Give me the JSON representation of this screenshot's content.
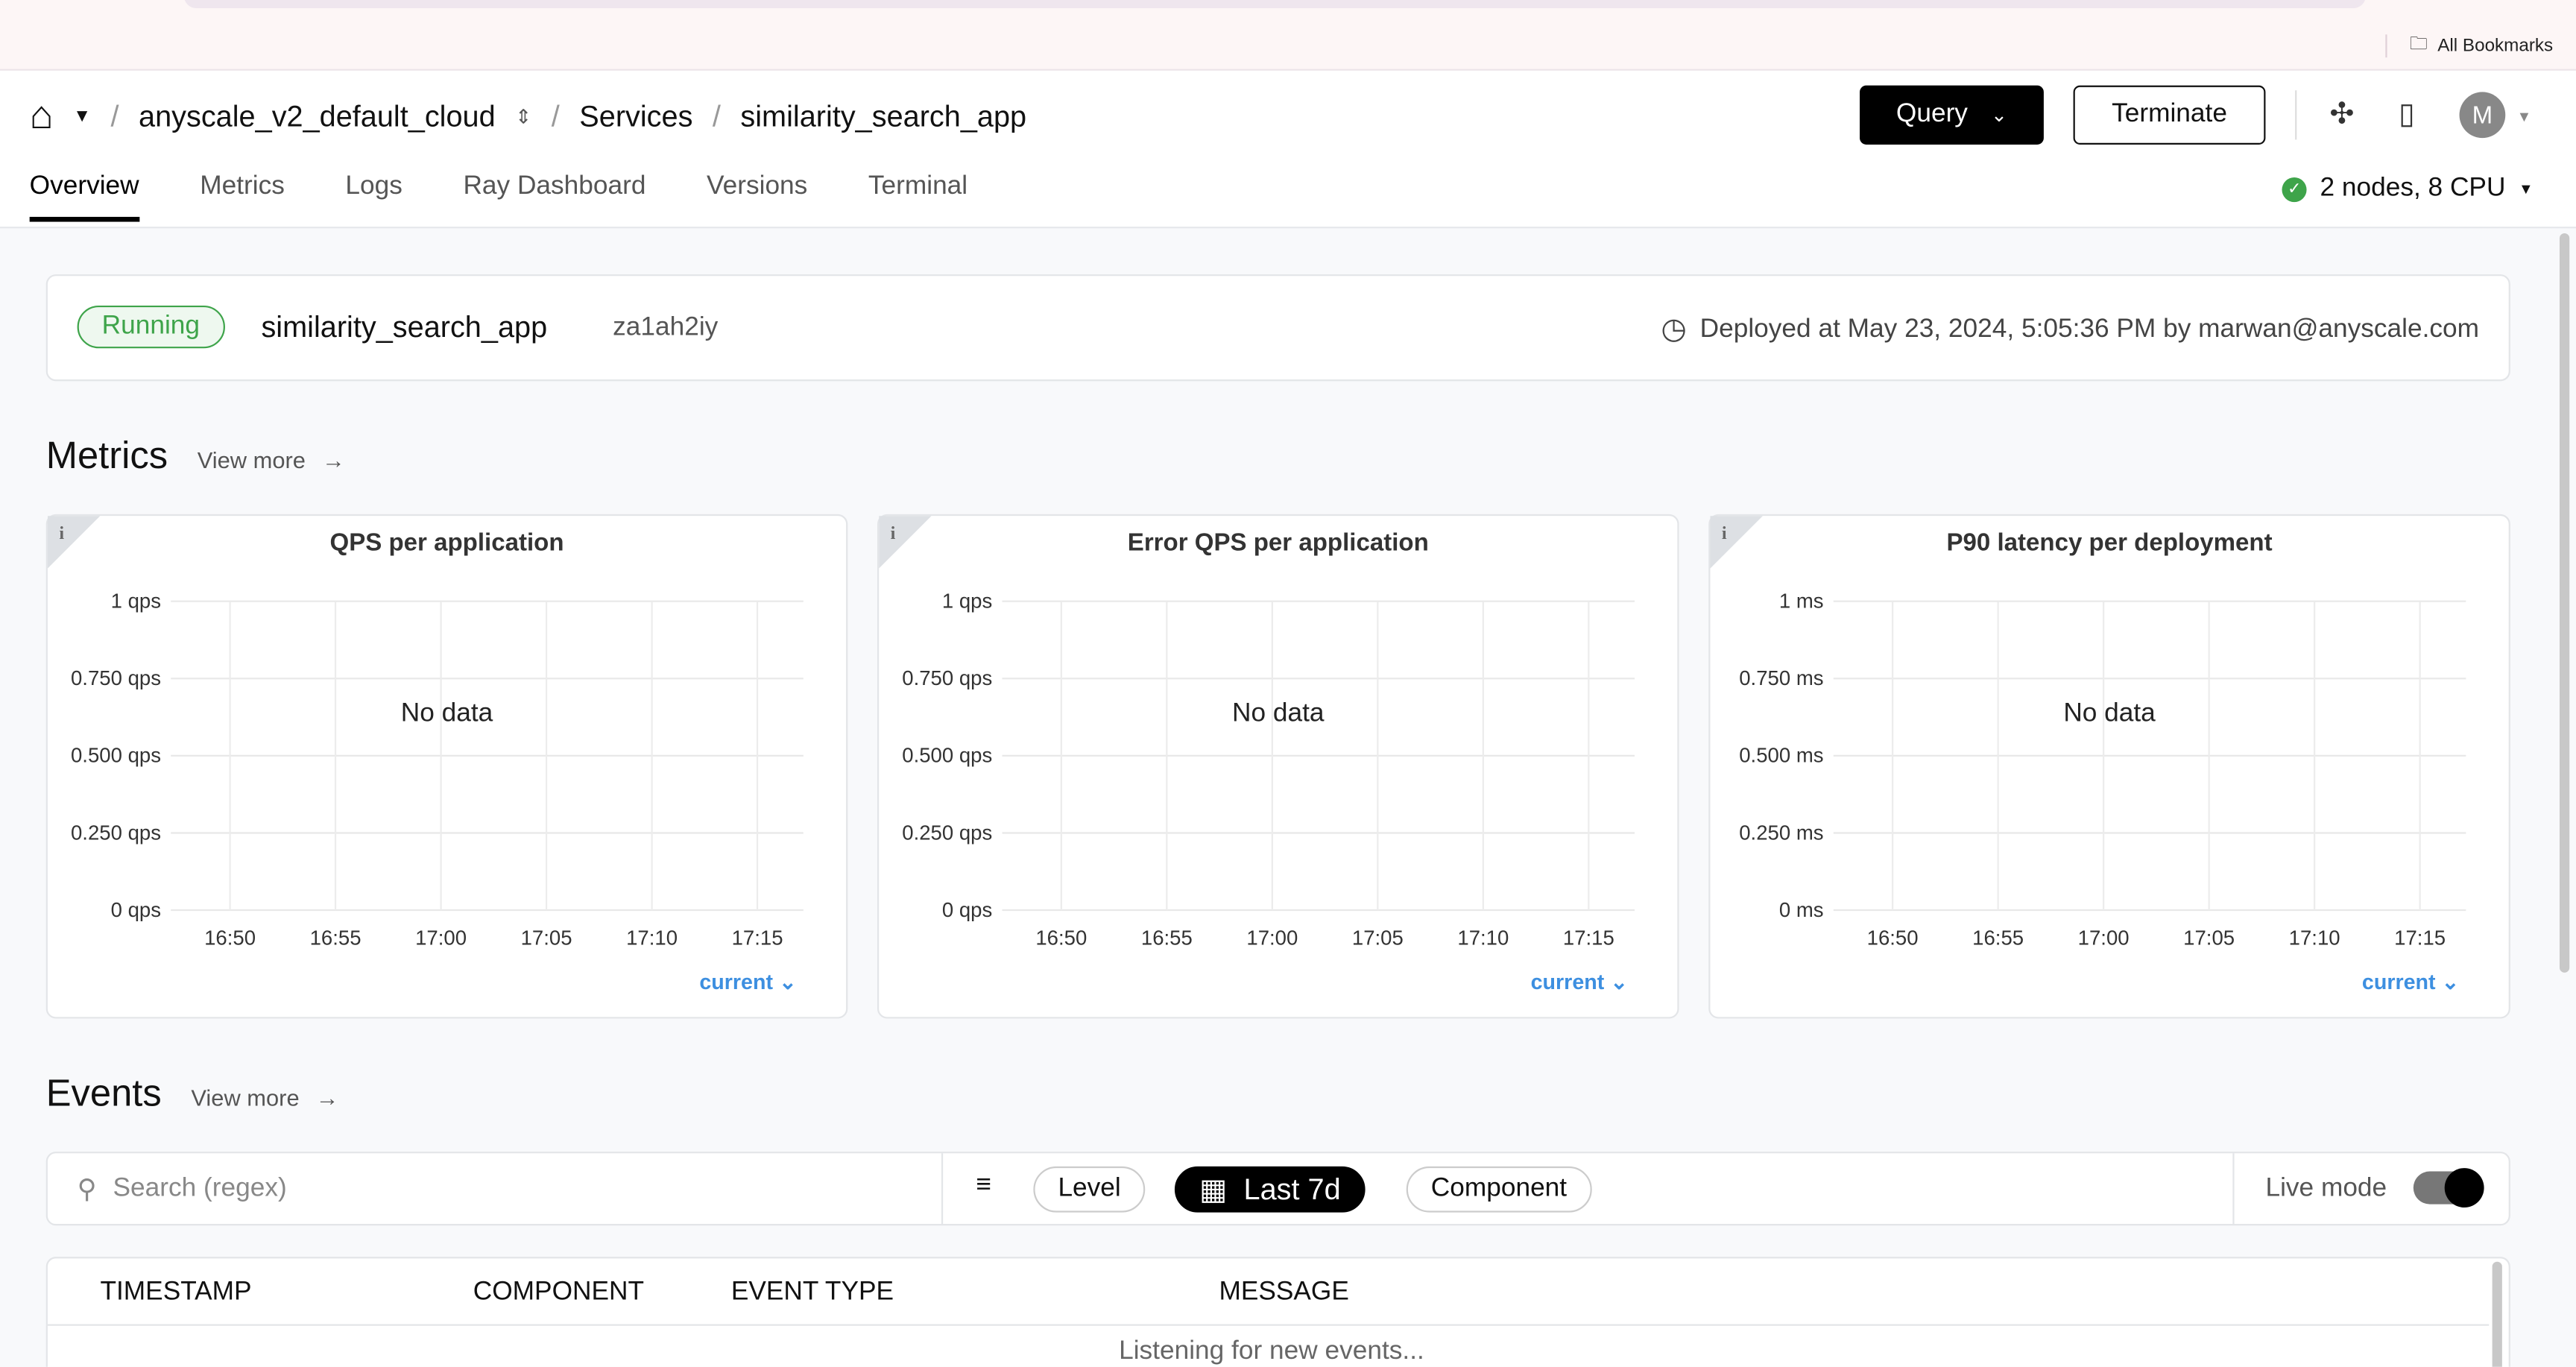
{
  "browser": {
    "bookmarks_label": "All Bookmarks"
  },
  "breadcrumb": {
    "cloud": "anyscale_v2_default_cloud",
    "section": "Services",
    "service": "similarity_search_app"
  },
  "header": {
    "query_label": "Query",
    "terminate_label": "Terminate",
    "avatar_initial": "M",
    "icons": [
      "slack-icon",
      "docs-icon"
    ]
  },
  "tabs": [
    {
      "label": "Overview",
      "active": true
    },
    {
      "label": "Metrics"
    },
    {
      "label": "Logs"
    },
    {
      "label": "Ray Dashboard"
    },
    {
      "label": "Versions"
    },
    {
      "label": "Terminal"
    }
  ],
  "cluster": {
    "summary": "2 nodes, 8 CPU",
    "status_color": "#3ea44a"
  },
  "status": {
    "state": "Running",
    "name": "similarity_search_app",
    "id": "za1ah2iy",
    "deployed": "Deployed at May 23, 2024, 5:05:36 PM by marwan@anyscale.com"
  },
  "metrics": {
    "title": "Metrics",
    "view_more": "View more"
  },
  "chart_data": [
    {
      "type": "line",
      "title": "QPS per application",
      "yticks": [
        "0 qps",
        "0.250 qps",
        "0.500 qps",
        "0.750 qps",
        "1 qps"
      ],
      "xticks": [
        "16:50",
        "16:55",
        "17:00",
        "17:05",
        "17:10",
        "17:15"
      ],
      "ylim": [
        0,
        1
      ],
      "grid": true,
      "series": [],
      "empty_text": "No data",
      "legend_label": "current"
    },
    {
      "type": "line",
      "title": "Error QPS per application",
      "yticks": [
        "0 qps",
        "0.250 qps",
        "0.500 qps",
        "0.750 qps",
        "1 qps"
      ],
      "xticks": [
        "16:50",
        "16:55",
        "17:00",
        "17:05",
        "17:10",
        "17:15"
      ],
      "ylim": [
        0,
        1
      ],
      "grid": true,
      "series": [],
      "empty_text": "No data",
      "legend_label": "current"
    },
    {
      "type": "line",
      "title": "P90 latency per deployment",
      "yticks": [
        "0 ms",
        "0.250 ms",
        "0.500 ms",
        "0.750 ms",
        "1 ms"
      ],
      "xticks": [
        "16:50",
        "16:55",
        "17:00",
        "17:05",
        "17:10",
        "17:15"
      ],
      "ylim": [
        0,
        1
      ],
      "grid": true,
      "series": [],
      "empty_text": "No data",
      "legend_label": "current"
    }
  ],
  "events": {
    "title": "Events",
    "view_more": "View more",
    "search_placeholder": "Search (regex)",
    "level": "Level",
    "range": "Last 7d",
    "component": "Component",
    "live_mode": "Live mode",
    "live_on": true,
    "columns": [
      "TIMESTAMP",
      "COMPONENT",
      "EVENT TYPE",
      "MESSAGE"
    ],
    "empty": "Listening for new events..."
  }
}
